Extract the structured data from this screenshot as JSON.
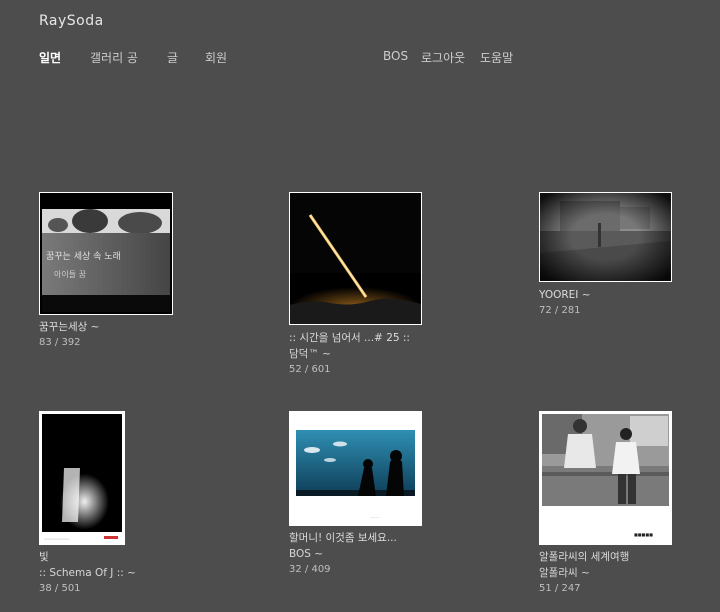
{
  "header": {
    "logo": "RaySoda"
  },
  "nav": {
    "left": [
      {
        "label": "일면",
        "active": true
      },
      {
        "label": "갤러리 공",
        "active": false
      },
      {
        "label": "글",
        "active": false
      },
      {
        "label": "회원",
        "active": false
      }
    ],
    "right": [
      {
        "label": "BOS"
      },
      {
        "label": "로그아웃"
      },
      {
        "label": "도움말"
      }
    ]
  },
  "cards": [
    {
      "title": "꿈꾸는세상 ~",
      "author": "",
      "count": "83 / 392"
    },
    {
      "title": ":: 시간을 넘어서 ...# 25 ::",
      "author": "담덕™ ~",
      "count": "52 / 601"
    },
    {
      "title": "YOOREI ~",
      "author": "",
      "count": "72 / 281"
    },
    {
      "title": "빛",
      "author": ":: Schema Of J :: ~",
      "count": "38 / 501"
    },
    {
      "title": "할머니! 이것좀 보세요...",
      "author": "BOS ~",
      "count": "32 / 409"
    },
    {
      "title": "알폴라씨의 세계여행",
      "author": "알폴라씨 ~",
      "count": "51 / 247"
    }
  ]
}
